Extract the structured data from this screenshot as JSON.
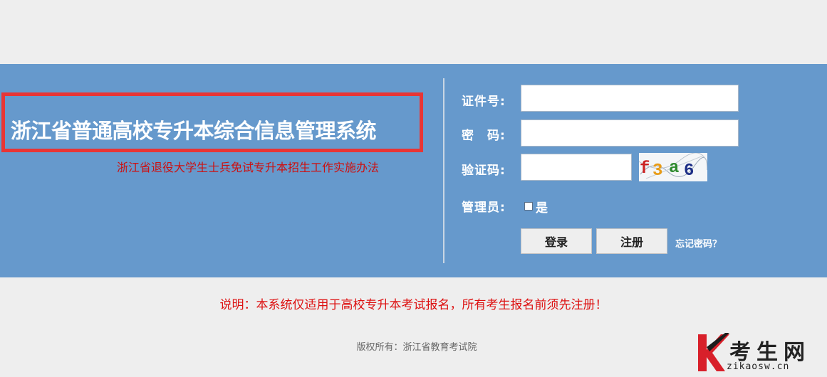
{
  "header": {
    "title": "浙江省普通高校专升本综合信息管理系统",
    "subtitle_link": "浙江省退役大学生士兵免试专升本招生工作实施办法"
  },
  "login_form": {
    "id_label": "证件号:",
    "password_label": "密　码:",
    "captcha_label": "验证码:",
    "admin_label": "管理员:",
    "id_value": "",
    "password_value": "",
    "captcha_value": "",
    "captcha_image_text": "f3a6",
    "admin_checkbox_label": "是",
    "admin_checked": false,
    "login_button": "登录",
    "register_button": "注册",
    "forgot_password_link": "忘记密码？"
  },
  "notice": "说明：本系统仅适用于高校专升本考试报名，所有考生报名前须先注册！",
  "footer": {
    "copyright": "版权所有：浙江省教育考试院"
  },
  "watermark": {
    "name": "考生网",
    "url": "zikaosw.cn"
  },
  "colors": {
    "band": "#6699cc",
    "title_frame": "#e83535",
    "notice_text": "#dd1111"
  }
}
